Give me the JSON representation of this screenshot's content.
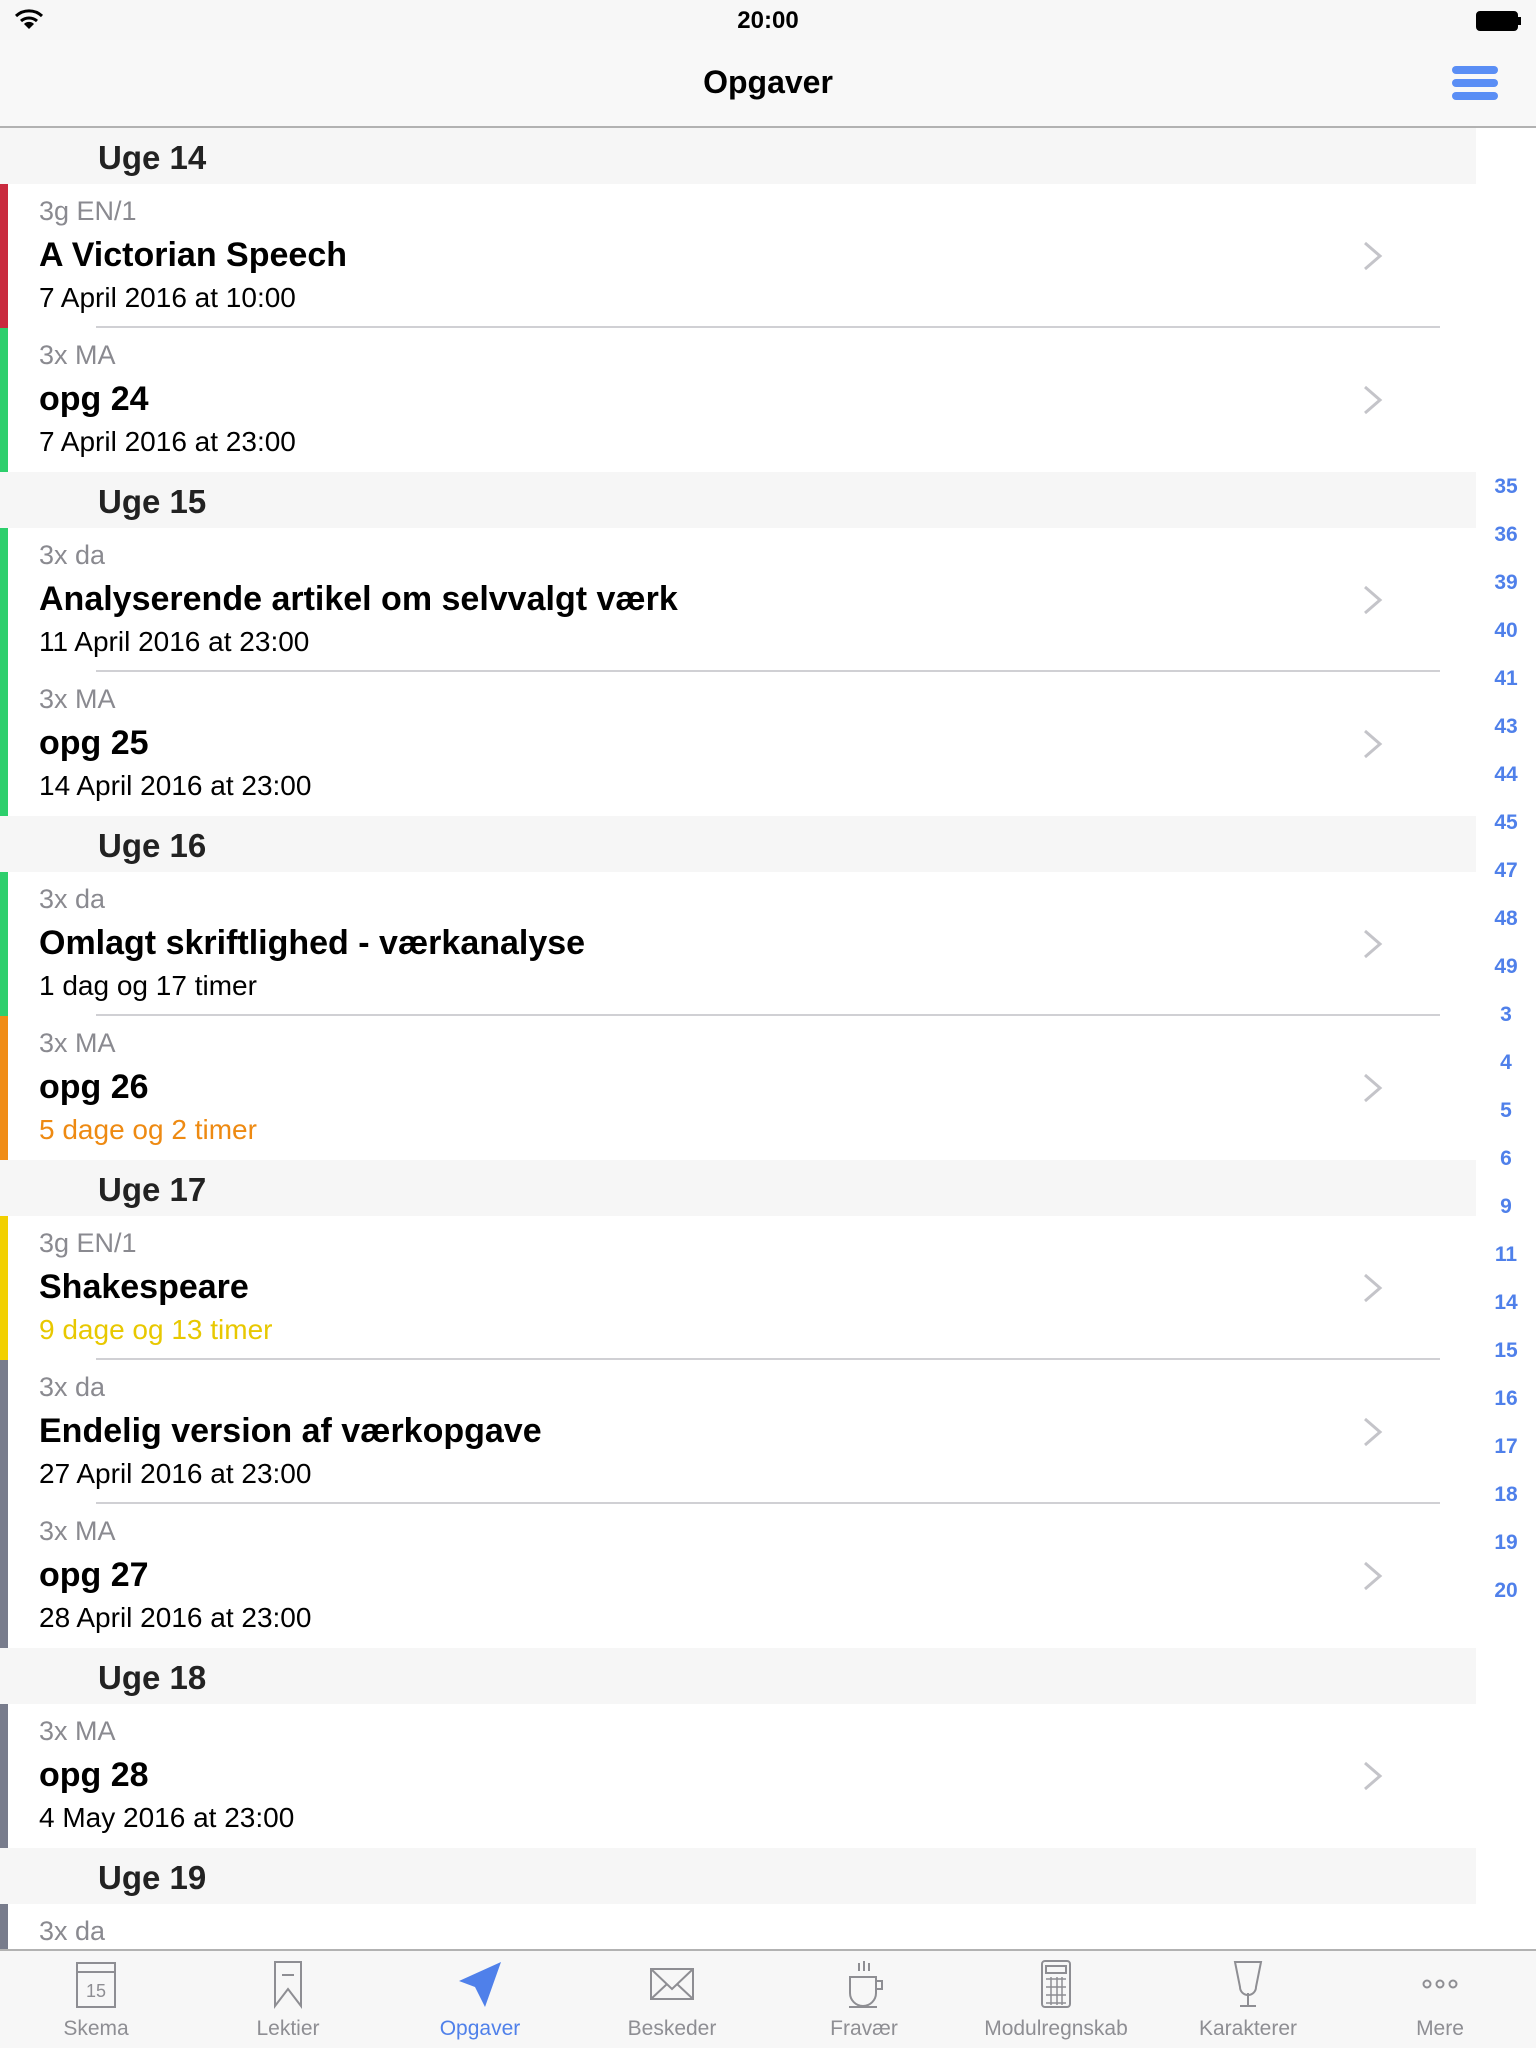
{
  "status_bar": {
    "time": "20:00"
  },
  "nav": {
    "title": "Opgaver",
    "menu_icon": "hamburger-menu-icon",
    "accent": "#5a8ef5"
  },
  "sections": [
    {
      "label": "Uge 14",
      "rows": [
        {
          "subject": "3g EN/1",
          "title": "A Victorian Speech",
          "date": "7 April 2016 at 10:00",
          "color": "#c92a3e",
          "date_color": "#000000"
        },
        {
          "subject": "3x MA",
          "title": "opg 24",
          "date": "7 April 2016 at 23:00",
          "color": "#2dcf6c",
          "date_color": "#000000"
        }
      ]
    },
    {
      "label": "Uge 15",
      "rows": [
        {
          "subject": "3x da",
          "title": "Analyserende artikel om selvvalgt værk",
          "date": "11 April 2016 at 23:00",
          "color": "#2dcf6c",
          "date_color": "#000000"
        },
        {
          "subject": "3x MA",
          "title": "opg 25",
          "date": "14 April 2016 at 23:00",
          "color": "#2dcf6c",
          "date_color": "#000000"
        }
      ]
    },
    {
      "label": "Uge 16",
      "rows": [
        {
          "subject": "3x da",
          "title": "Omlagt skriftlighed - værkanalyse",
          "date": "1 dag og 17 timer",
          "color": "#2dcf6c",
          "date_color": "#000000"
        },
        {
          "subject": "3x MA",
          "title": "opg 26",
          "date": "5 dage og 2 timer",
          "color": "#f08c16",
          "date_color": "#ee8a12"
        }
      ]
    },
    {
      "label": "Uge 17",
      "rows": [
        {
          "subject": "3g EN/1",
          "title": "Shakespeare",
          "date": "9 dage og 13 timer",
          "color": "#f2d000",
          "date_color": "#e8c800"
        },
        {
          "subject": "3x da",
          "title": "Endelig version af værkopgave",
          "date": "27 April 2016 at 23:00",
          "color": "#787c8c",
          "date_color": "#000000"
        },
        {
          "subject": "3x MA",
          "title": "opg 27",
          "date": "28 April 2016 at 23:00",
          "color": "#787c8c",
          "date_color": "#000000"
        }
      ]
    },
    {
      "label": "Uge 18",
      "rows": [
        {
          "subject": "3x MA",
          "title": "opg 28",
          "date": "4 May 2016 at 23:00",
          "color": "#787c8c",
          "date_color": "#000000"
        }
      ]
    },
    {
      "label": "Uge 19",
      "rows": [
        {
          "subject": "3x da",
          "title": "",
          "date": "",
          "color": "#787c8c",
          "date_color": "#000000"
        }
      ]
    }
  ],
  "index": [
    "35",
    "36",
    "39",
    "40",
    "41",
    "43",
    "44",
    "45",
    "47",
    "48",
    "49",
    "3",
    "4",
    "5",
    "6",
    "9",
    "11",
    "14",
    "15",
    "16",
    "17",
    "18",
    "19",
    "20"
  ],
  "tabs": [
    {
      "label": "Skema",
      "icon": "calendar-icon",
      "calendar_day": "15"
    },
    {
      "label": "Lektier",
      "icon": "bookmark-icon"
    },
    {
      "label": "Opgaver",
      "icon": "paper-plane-icon",
      "active": true
    },
    {
      "label": "Beskeder",
      "icon": "envelope-icon"
    },
    {
      "label": "Fravær",
      "icon": "coffee-cup-icon"
    },
    {
      "label": "Modulregnskab",
      "icon": "calculator-icon"
    },
    {
      "label": "Karakterer",
      "icon": "trophy-icon"
    },
    {
      "label": "Mere",
      "icon": "more-dots-icon"
    }
  ]
}
